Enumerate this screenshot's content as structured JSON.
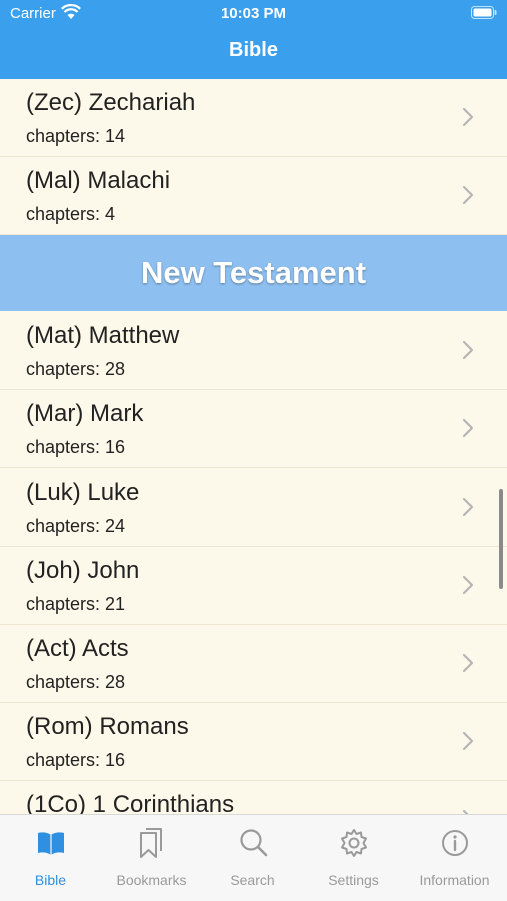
{
  "status_bar": {
    "carrier": "Carrier",
    "time": "10:03 PM"
  },
  "nav": {
    "title": "Bible"
  },
  "old_testament_tail": [
    {
      "title": "(Zec) Zechariah",
      "chapters": "chapters: 14"
    },
    {
      "title": "(Mal) Malachi",
      "chapters": "chapters: 4"
    }
  ],
  "section_header": "New Testament",
  "new_testament": [
    {
      "title": "(Mat) Matthew",
      "chapters": "chapters: 28"
    },
    {
      "title": "(Mar) Mark",
      "chapters": "chapters: 16"
    },
    {
      "title": "(Luk) Luke",
      "chapters": "chapters: 24"
    },
    {
      "title": "(Joh) John",
      "chapters": "chapters: 21"
    },
    {
      "title": "(Act) Acts",
      "chapters": "chapters: 28"
    },
    {
      "title": "(Rom) Romans",
      "chapters": "chapters: 16"
    },
    {
      "title": "(1Co) 1 Corinthians",
      "chapters": ""
    }
  ],
  "tabs": [
    {
      "label": "Bible",
      "icon": "book-icon",
      "active": true
    },
    {
      "label": "Bookmarks",
      "icon": "bookmarks-icon",
      "active": false
    },
    {
      "label": "Search",
      "icon": "search-icon",
      "active": false
    },
    {
      "label": "Settings",
      "icon": "gear-icon",
      "active": false
    },
    {
      "label": "Information",
      "icon": "info-icon",
      "active": false
    }
  ],
  "colors": {
    "accent": "#3aa0ed",
    "section": "#8dbff0",
    "background": "#fdf9ea",
    "tab_active": "#2f8fe0",
    "tab_inactive": "#9a9a9a"
  }
}
